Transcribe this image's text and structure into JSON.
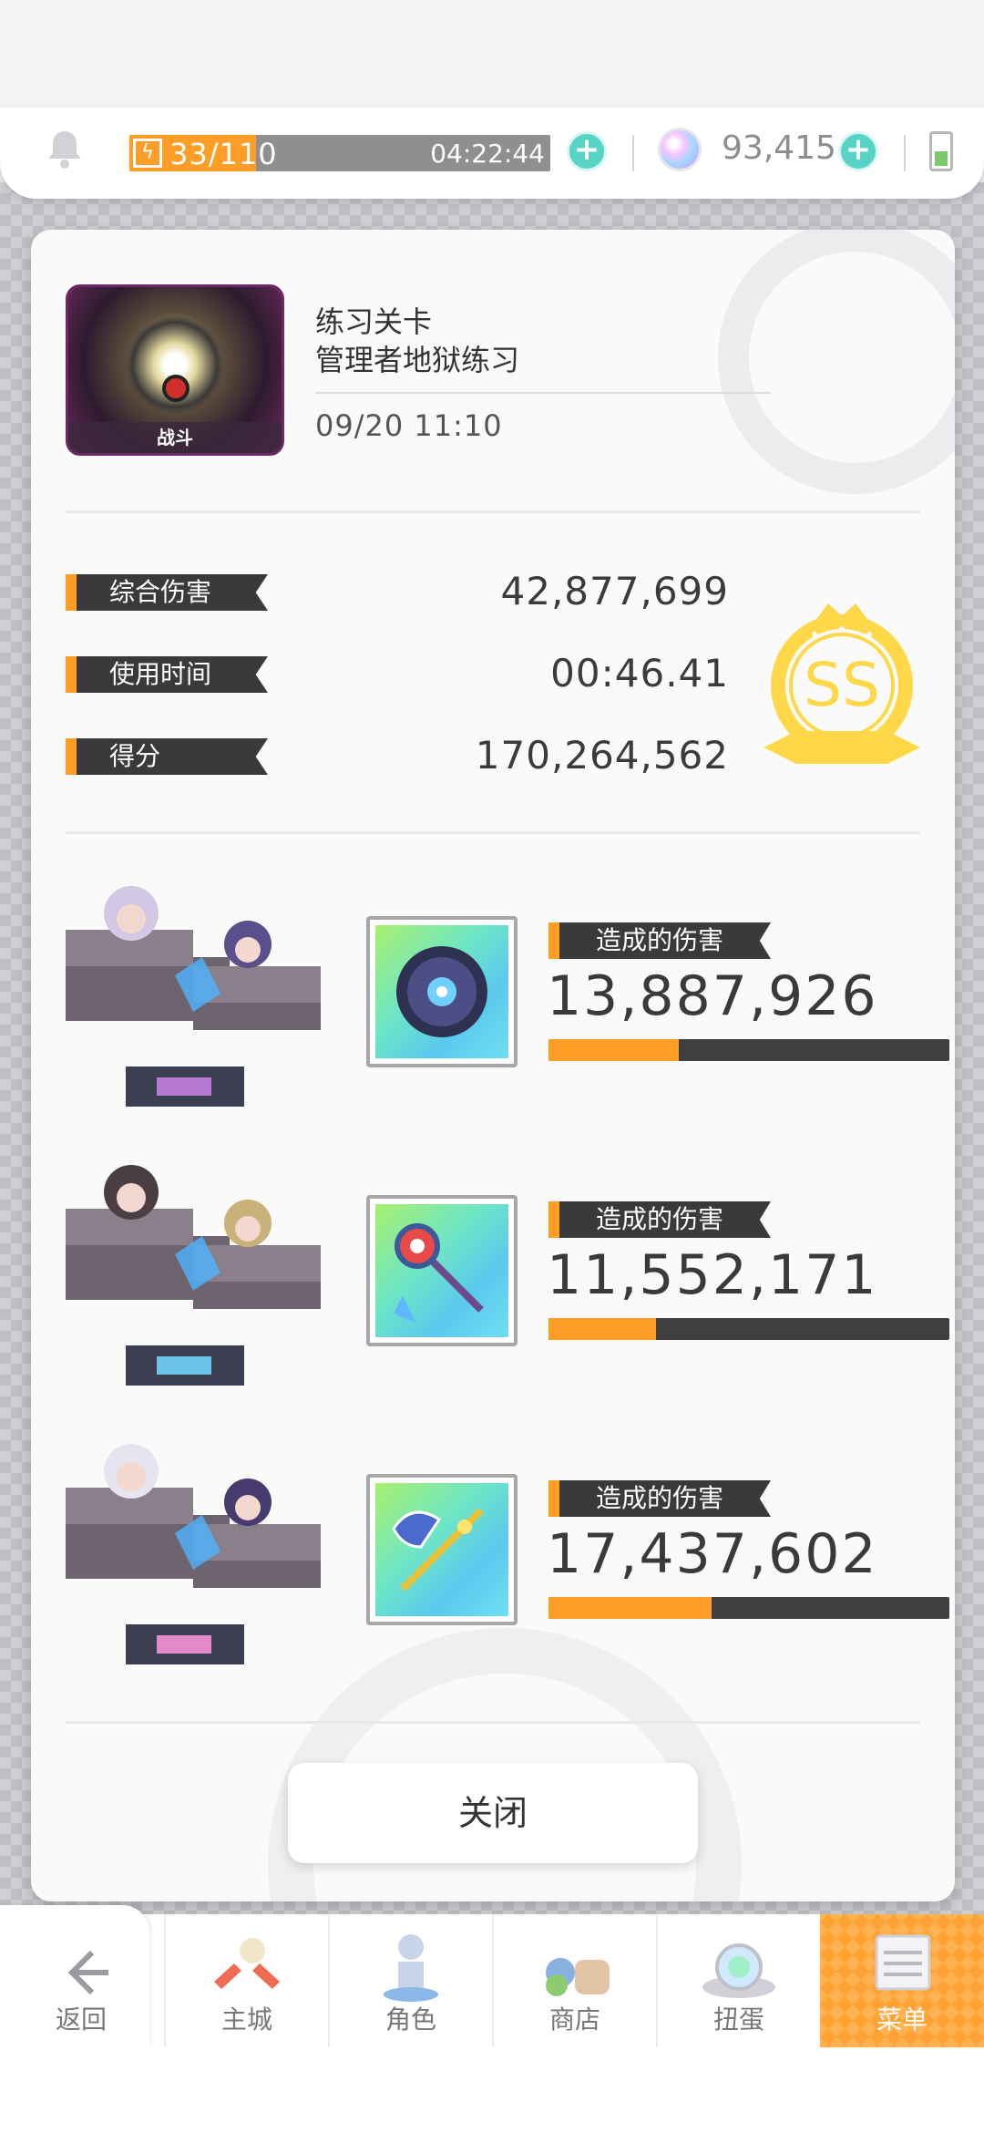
{
  "status": {
    "stamina": "33/110",
    "stamina_fraction": 0.3,
    "timer": "04:22:44",
    "gems": "93,415"
  },
  "stage": {
    "thumb_label": "战斗",
    "type": "练习关卡",
    "name": "管理者地狱练习",
    "date": "09/20 11:10"
  },
  "stats": [
    {
      "label": "综合伤害",
      "value": "42,877,699"
    },
    {
      "label": "使用时间",
      "value": "00:46.41"
    },
    {
      "label": "得分",
      "value": "170,264,562"
    }
  ],
  "rank": "SS",
  "characters": [
    {
      "damage_label": "造成的伤害",
      "damage": "13,887,926",
      "share": 0.324,
      "weapon_icon": "orb-icon"
    },
    {
      "damage_label": "造成的伤害",
      "damage": "11,552,171",
      "share": 0.269,
      "weapon_icon": "scepter-icon"
    },
    {
      "damage_label": "造成的伤害",
      "damage": "17,437,602",
      "share": 0.407,
      "weapon_icon": "axe-staff-icon"
    }
  ],
  "close_label": "关闭",
  "nav": [
    {
      "label": "返回",
      "icon": "back-arrow-icon"
    },
    {
      "label": "主城",
      "icon": "town-icon"
    },
    {
      "label": "角色",
      "icon": "character-icon"
    },
    {
      "label": "商店",
      "icon": "shop-icon"
    },
    {
      "label": "扭蛋",
      "icon": "gacha-icon"
    },
    {
      "label": "菜单",
      "icon": "menu-icon"
    }
  ],
  "colors": {
    "accent": "#ff9e27",
    "dark_tag": "#3a3a3c",
    "teal": "#57d4c6",
    "gold": "#ffd84a"
  }
}
